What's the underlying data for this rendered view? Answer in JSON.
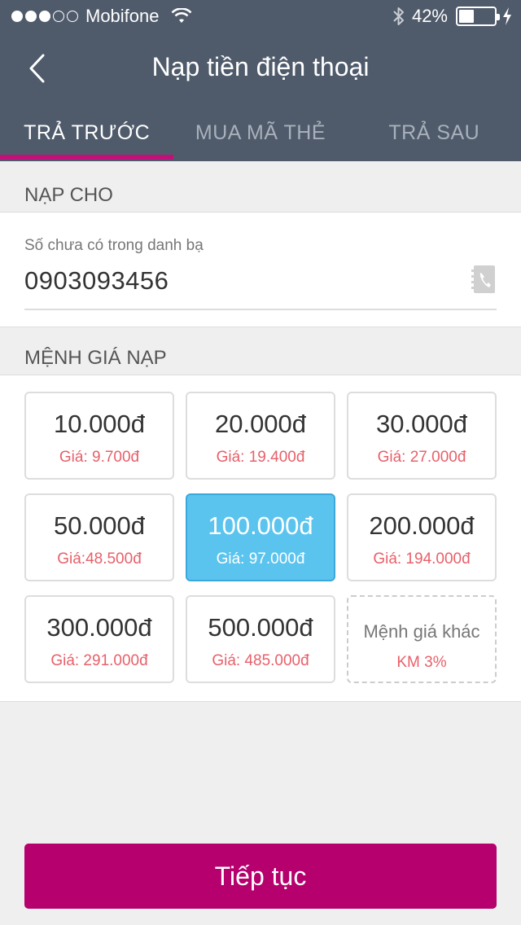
{
  "status_bar": {
    "signal_dots_full": 3,
    "signal_dots_total": 5,
    "carrier": "Mobifone",
    "battery_text": "42%",
    "battery_level": 0.42
  },
  "header": {
    "title": "Nạp tiền điện thoại"
  },
  "tabs": [
    {
      "label": "TRẢ TRƯỚC",
      "active": true
    },
    {
      "label": "MUA MÃ THẺ",
      "active": false
    },
    {
      "label": "TRẢ SAU",
      "active": false
    }
  ],
  "recipient": {
    "section_label": "NẠP CHO",
    "hint": "Số chưa có trong danh bạ",
    "phone": "0903093456"
  },
  "denominations": {
    "section_label": "MỆNH GIÁ NẠP",
    "items": [
      {
        "amount": "10.000đ",
        "price": "Giá: 9.700đ"
      },
      {
        "amount": "20.000đ",
        "price": "Giá: 19.400đ"
      },
      {
        "amount": "30.000đ",
        "price": "Giá: 27.000đ"
      },
      {
        "amount": "50.000đ",
        "price": "Giá:48.500đ"
      },
      {
        "amount": "100.000đ",
        "price": "Giá: 97.000đ",
        "selected": true
      },
      {
        "amount": "200.000đ",
        "price": "Giá: 194.000đ"
      },
      {
        "amount": "300.000đ",
        "price": "Giá: 291.000đ"
      },
      {
        "amount": "500.000đ",
        "price": "Giá: 485.000đ"
      },
      {
        "amount": "Mệnh giá khác",
        "price": "KM 3%",
        "other": true
      }
    ]
  },
  "actions": {
    "continue_label": "Tiếp tục"
  },
  "colors": {
    "header_bg": "#4f5b6b",
    "accent": "#b5006e",
    "selected_card": "#5bc4ee",
    "price_text": "#e8606a"
  }
}
